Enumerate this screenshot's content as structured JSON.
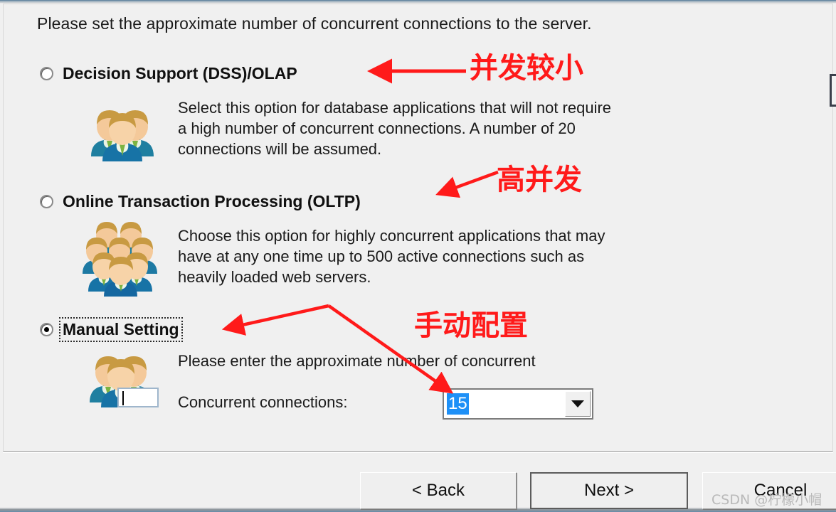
{
  "dialog": {
    "intro": "Please set the approximate number of concurrent connections to the server."
  },
  "options": [
    {
      "id": "dss-olap",
      "title": "Decision Support (DSS)/OLAP",
      "selected": false,
      "focused": false,
      "body": "Select this option for database applications that will not require\na high number of concurrent connections. A number of 20\nconnections will be assumed.",
      "icon": "people-group-small-icon"
    },
    {
      "id": "oltp",
      "title": "Online Transaction Processing (OLTP)",
      "selected": false,
      "focused": false,
      "body": "Choose this option for highly concurrent applications that may\nhave at any one time up to 500 active connections such as\nheavily loaded web servers.",
      "icon": "people-group-large-icon"
    },
    {
      "id": "manual",
      "title": "Manual Setting",
      "selected": true,
      "focused": true,
      "body": "Please enter the approximate number of concurrent",
      "icon": "people-group-input-icon"
    }
  ],
  "manual": {
    "hint": "Please enter the approximate number of concurrent",
    "field_label": "Concurrent connections:",
    "value": "15",
    "dropdown_icon": "chevron-down-icon",
    "selection_color": "#1e90f7"
  },
  "buttons": {
    "back": "< Back",
    "next": "Next >",
    "cancel": "Cancel"
  },
  "annotations": {
    "color": "#ff1a1a",
    "low_concurrency": "并发较小",
    "high_concurrency": "高并发",
    "manual_config": "手动配置"
  },
  "watermark": "CSDN @柠檬小帽"
}
